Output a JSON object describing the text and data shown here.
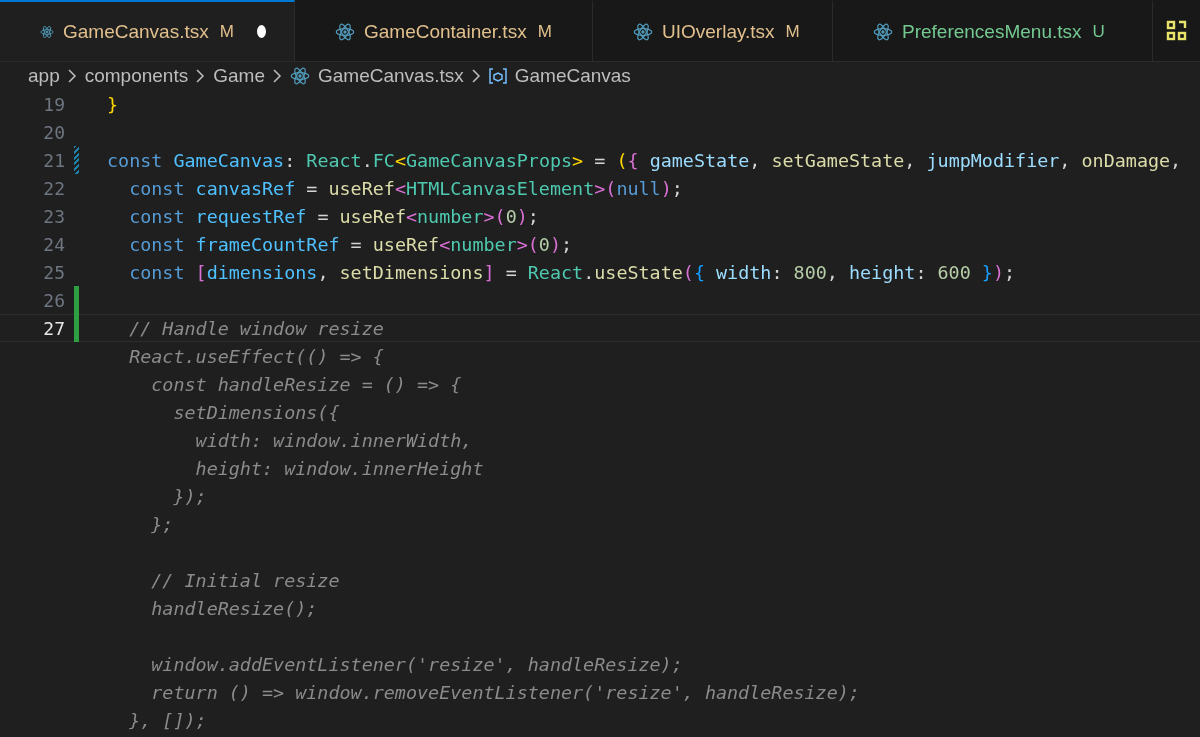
{
  "tabs": [
    {
      "label": "GameCanvas.tsx",
      "status": "M",
      "color": "#e2c08d",
      "selected": true,
      "dirty": true
    },
    {
      "label": "GameContainer.tsx",
      "status": "M",
      "color": "#e2c08d",
      "selected": false,
      "dirty": false
    },
    {
      "label": "UIOverlay.tsx",
      "status": "M",
      "color": "#e2c08d",
      "selected": false,
      "dirty": false
    },
    {
      "label": "PreferencesMenu.tsx",
      "status": "U",
      "color": "#73c991",
      "selected": false,
      "dirty": false
    }
  ],
  "breadcrumb": [
    {
      "label": "app",
      "kind": "folder"
    },
    {
      "label": "components",
      "kind": "folder"
    },
    {
      "label": "Game",
      "kind": "folder"
    },
    {
      "label": "GameCanvas.tsx",
      "kind": "react-file"
    },
    {
      "label": "GameCanvas",
      "kind": "symbol"
    }
  ],
  "lines": [
    {
      "number": "19",
      "current": false,
      "added": false,
      "modified": false,
      "tokens": [
        {
          "kind": "gold",
          "text": "}"
        }
      ]
    },
    {
      "number": "20",
      "current": false,
      "added": false,
      "modified": false
    },
    {
      "number": "21",
      "current": false,
      "added": false,
      "modified": true,
      "tokens": [
        {
          "kind": "kw",
          "text": "const "
        },
        {
          "kind": "const",
          "text": "GameCanvas"
        },
        {
          "kind": "punct",
          "text": ": "
        },
        {
          "kind": "type",
          "text": "React"
        },
        {
          "kind": "punct",
          "text": "."
        },
        {
          "kind": "type",
          "text": "FC"
        },
        {
          "kind": "gold",
          "text": "<"
        },
        {
          "kind": "type",
          "text": "GameCanvasProps"
        },
        {
          "kind": "gold",
          "text": ">"
        },
        {
          "kind": "punct",
          "text": " = "
        },
        {
          "kind": "gold",
          "text": "("
        },
        {
          "kind": "pink",
          "text": "{"
        },
        {
          "kind": "var",
          "text": " gameState"
        },
        {
          "kind": "punct",
          "text": ", "
        },
        {
          "kind": "fn",
          "text": "setGameState"
        },
        {
          "kind": "punct",
          "text": ", "
        },
        {
          "kind": "var",
          "text": "jumpModifier"
        },
        {
          "kind": "punct",
          "text": ", "
        },
        {
          "kind": "fn",
          "text": "onDamage"
        },
        {
          "kind": "punct",
          "text": ","
        }
      ]
    },
    {
      "number": "22",
      "current": false,
      "added": false,
      "modified": false,
      "tokens": [
        {
          "kind": "kw",
          "text": "  const"
        },
        {
          "kind": "const",
          "text": " canvasRef"
        },
        {
          "kind": "punct",
          "text": " = "
        },
        {
          "kind": "fn",
          "text": "useRef"
        },
        {
          "kind": "pink",
          "text": "<"
        },
        {
          "kind": "type",
          "text": "HTMLCanvasElement"
        },
        {
          "kind": "pink",
          "text": ">("
        },
        {
          "kind": "kw",
          "text": "null"
        },
        {
          "kind": "pink",
          "text": ")"
        },
        {
          "kind": "punct",
          "text": ";"
        }
      ]
    },
    {
      "number": "23",
      "current": false,
      "added": false,
      "modified": false,
      "tokens": [
        {
          "kind": "kw",
          "text": "  const"
        },
        {
          "kind": "const",
          "text": " requestRef"
        },
        {
          "kind": "punct",
          "text": " = "
        },
        {
          "kind": "fn",
          "text": "useRef"
        },
        {
          "kind": "pink",
          "text": "<"
        },
        {
          "kind": "type",
          "text": "number"
        },
        {
          "kind": "pink",
          "text": ">("
        },
        {
          "kind": "num",
          "text": "0"
        },
        {
          "kind": "pink",
          "text": ")"
        },
        {
          "kind": "punct",
          "text": ";"
        }
      ]
    },
    {
      "number": "24",
      "current": false,
      "added": false,
      "modified": false,
      "tokens": [
        {
          "kind": "kw",
          "text": "  const"
        },
        {
          "kind": "const",
          "text": " frameCountRef"
        },
        {
          "kind": "punct",
          "text": " = "
        },
        {
          "kind": "fn",
          "text": "useRef"
        },
        {
          "kind": "pink",
          "text": "<"
        },
        {
          "kind": "type",
          "text": "number"
        },
        {
          "kind": "pink",
          "text": ">("
        },
        {
          "kind": "num",
          "text": "0"
        },
        {
          "kind": "pink",
          "text": ")"
        },
        {
          "kind": "punct",
          "text": ";"
        }
      ]
    },
    {
      "number": "25",
      "current": false,
      "added": false,
      "modified": false,
      "tokens": [
        {
          "kind": "kw",
          "text": "  const "
        },
        {
          "kind": "pink",
          "text": "["
        },
        {
          "kind": "const",
          "text": "dimensions"
        },
        {
          "kind": "punct",
          "text": ", "
        },
        {
          "kind": "fn",
          "text": "setDimensions"
        },
        {
          "kind": "pink",
          "text": "]"
        },
        {
          "kind": "punct",
          "text": " = "
        },
        {
          "kind": "type",
          "text": "React"
        },
        {
          "kind": "punct",
          "text": "."
        },
        {
          "kind": "fn",
          "text": "useState"
        },
        {
          "kind": "pink",
          "text": "("
        },
        {
          "kind": "blue",
          "text": "{"
        },
        {
          "kind": "var",
          "text": " width"
        },
        {
          "kind": "punct",
          "text": ": "
        },
        {
          "kind": "num",
          "text": "800"
        },
        {
          "kind": "punct",
          "text": ", "
        },
        {
          "kind": "var",
          "text": "height"
        },
        {
          "kind": "punct",
          "text": ": "
        },
        {
          "kind": "num",
          "text": "600"
        },
        {
          "kind": "blue",
          "text": " }"
        },
        {
          "kind": "pink",
          "text": ")"
        },
        {
          "kind": "punct",
          "text": ";"
        }
      ]
    },
    {
      "number": "26",
      "current": false,
      "added": true,
      "modified": false
    },
    {
      "number": "27",
      "current": true,
      "added": true,
      "modified": false,
      "tokens": [
        {
          "kind": "ghost",
          "text": "  // Handle window resize"
        }
      ]
    }
  ],
  "suggestion": [
    {
      "text": "  React.useEffect(() => {",
      "gap_before": false
    },
    {
      "text": "    const handleResize = () => {",
      "gap_before": false
    },
    {
      "text": "      setDimensions({",
      "gap_before": false
    },
    {
      "text": "        width: window.innerWidth,",
      "gap_before": false
    },
    {
      "text": "        height: window.innerHeight",
      "gap_before": false
    },
    {
      "text": "      });",
      "gap_before": false
    },
    {
      "text": "    };",
      "gap_before": false
    },
    {
      "text": "    // Initial resize",
      "gap_before": true
    },
    {
      "text": "    handleResize();",
      "gap_before": false
    },
    {
      "text": "    window.addEventListener('resize', handleResize);",
      "gap_before": true
    },
    {
      "text": "    return () => window.removeEventListener('resize', handleResize);",
      "gap_before": false
    },
    {
      "text": "  }, []);",
      "gap_before": false
    }
  ]
}
